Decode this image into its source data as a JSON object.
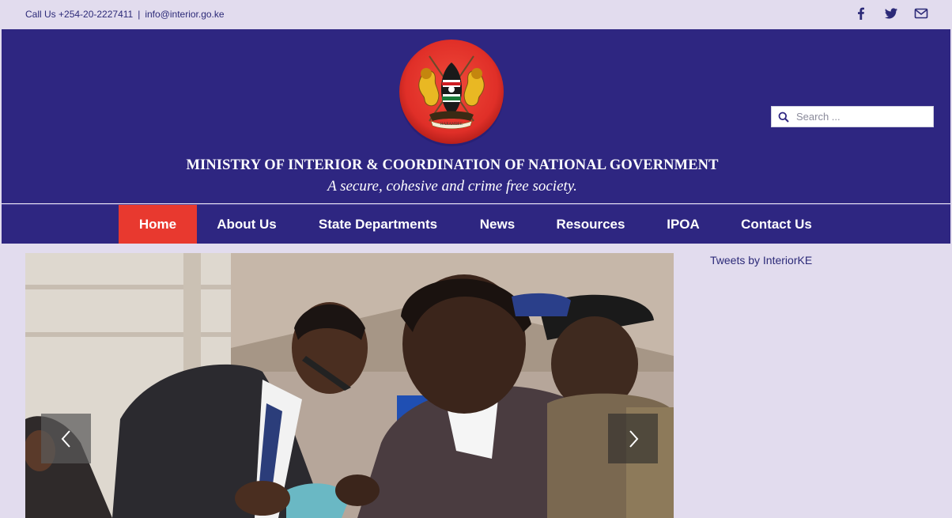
{
  "topbar": {
    "call_text": "Call Us +254-20-2227411",
    "separator": "|",
    "email": "info@interior.go.ke",
    "social": [
      "facebook-icon",
      "twitter-icon",
      "envelope-icon"
    ]
  },
  "header": {
    "seal_alt": "Coat of Arms of Kenya",
    "title": "MINISTRY OF INTERIOR & COORDINATION OF  NATIONAL GOVERNMENT",
    "tagline": "A secure, cohesive and crime free society.",
    "search_placeholder": "Search ..."
  },
  "nav": {
    "items": [
      {
        "label": "Home",
        "active": true
      },
      {
        "label": "About Us"
      },
      {
        "label": "State Departments"
      },
      {
        "label": "News"
      },
      {
        "label": "Resources"
      },
      {
        "label": "IPOA"
      },
      {
        "label": "Contact Us"
      }
    ]
  },
  "sidebar": {
    "tweets_link": "Tweets by InteriorKE"
  },
  "colors": {
    "page_bg": "#e2dcee",
    "header_bg": "#2e2681",
    "active_nav": "#e8392f",
    "text_link": "#2c2a78"
  }
}
